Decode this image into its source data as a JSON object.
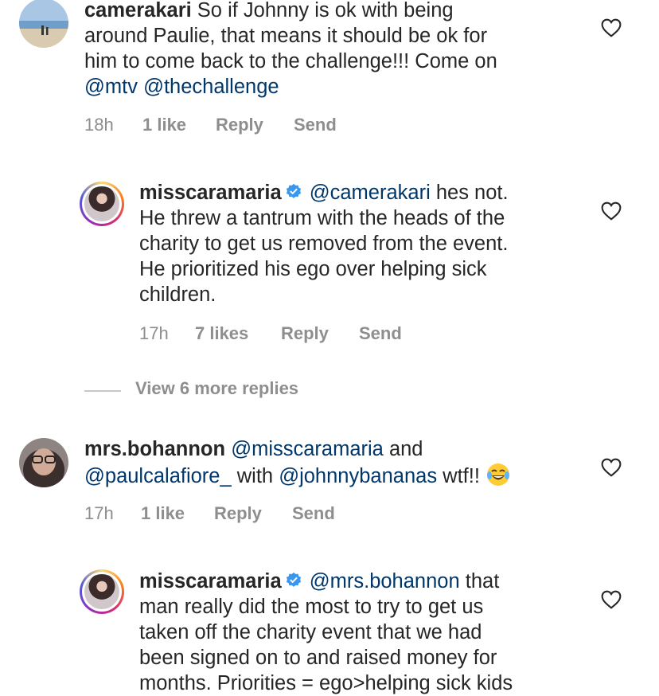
{
  "comments": [
    {
      "username": "camerakari",
      "lines": [
        [
          {
            "t": "So if Johnny is ok with being",
            "m": false
          }
        ],
        [
          {
            "t": "around Paulie, that means it should be ok for",
            "m": false
          }
        ],
        [
          {
            "t": "him to come back to the challenge!!! Come on",
            "m": false
          }
        ],
        [
          {
            "t": "@mtv",
            "m": true
          },
          {
            "t": " ",
            "m": false
          },
          {
            "t": "@thechallenge",
            "m": true
          }
        ]
      ],
      "time": "18h",
      "likes": "1 like",
      "reply": "Reply",
      "send": "Send"
    },
    {
      "username": "misscaramaria",
      "lines": [
        [
          {
            "t": "@camerakari",
            "m": true
          },
          {
            "t": " hes not.",
            "m": false
          }
        ],
        [
          {
            "t": "He threw a tantrum with the heads of the",
            "m": false
          }
        ],
        [
          {
            "t": "charity to get us removed from the event.",
            "m": false
          }
        ],
        [
          {
            "t": "He prioritized his ego over helping sick",
            "m": false
          }
        ],
        [
          {
            "t": "children.",
            "m": false
          }
        ]
      ],
      "time": "17h",
      "likes": "7 likes",
      "reply": "Reply",
      "send": "Send"
    },
    {
      "username": "mrs.bohannon",
      "lines": [
        [
          {
            "t": "@misscaramaria",
            "m": true
          },
          {
            "t": " and",
            "m": false
          }
        ],
        [
          {
            "t": "@paulcalafiore_",
            "m": true
          },
          {
            "t": " with ",
            "m": false
          },
          {
            "t": "@johnnybananas",
            "m": true
          },
          {
            "t": " wtf!! ",
            "m": false
          }
        ]
      ],
      "time": "17h",
      "likes": "1 like",
      "reply": "Reply",
      "send": "Send"
    },
    {
      "username": "misscaramaria",
      "lines": [
        [
          {
            "t": "@mrs.bohannon",
            "m": true
          },
          {
            "t": " that",
            "m": false
          }
        ],
        [
          {
            "t": "man really did the most to try to get us",
            "m": false
          }
        ],
        [
          {
            "t": "taken off the charity event that we had",
            "m": false
          }
        ],
        [
          {
            "t": "been signed on to and raised money for",
            "m": false
          }
        ],
        [
          {
            "t": "months. Priorities = ego>helping sick kids",
            "m": false
          }
        ]
      ]
    }
  ],
  "view_more": "View 6 more replies",
  "icons": {
    "heart": "heart-outline-icon",
    "verified": "verified-badge-icon",
    "emoji": "laughing-tears-emoji"
  },
  "colors": {
    "mention": "#00376b",
    "verified": "#3897f0",
    "meta": "#8e8e8e"
  }
}
